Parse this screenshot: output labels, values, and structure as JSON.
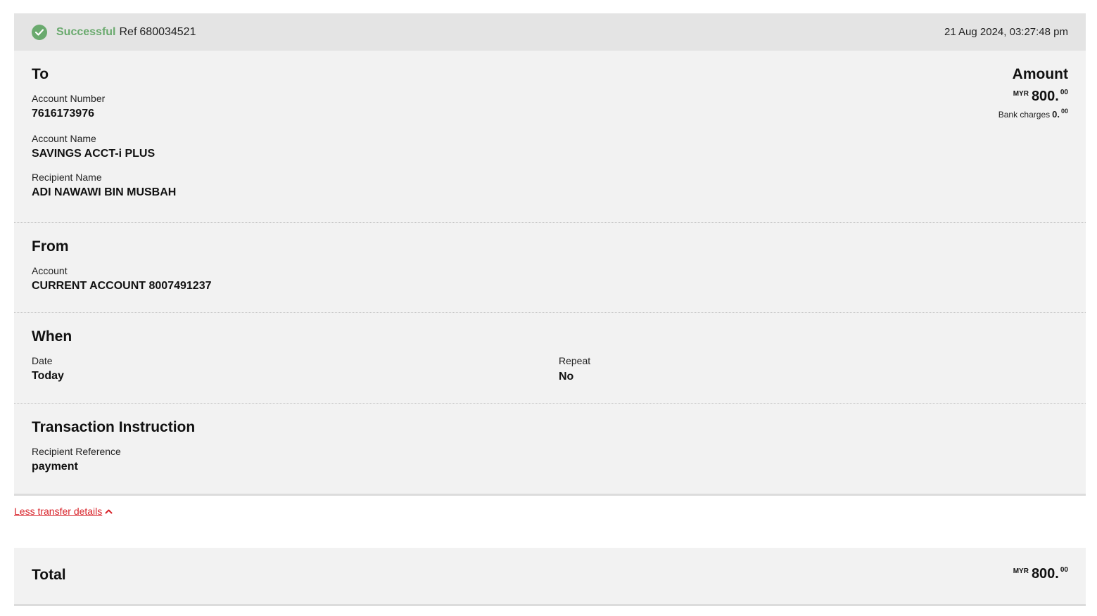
{
  "header": {
    "status": "Successful",
    "ref_label": "Ref",
    "ref_number": "680034521",
    "timestamp": "21 Aug 2024, 03:27:48 pm",
    "status_color": "#6aaa6e"
  },
  "to": {
    "title": "To",
    "account_number_label": "Account Number",
    "account_number": "7616173976",
    "account_name_label": "Account Name",
    "account_name": "SAVINGS ACCT-i PLUS",
    "recipient_name_label": "Recipient Name",
    "recipient_name": "ADI NAWAWI BIN MUSBAH"
  },
  "amount": {
    "title": "Amount",
    "currency": "MYR",
    "integer": "800.",
    "decimals": "00",
    "bank_charges_label": "Bank charges",
    "bank_charges_integer": "0.",
    "bank_charges_decimals": "00"
  },
  "from": {
    "title": "From",
    "account_label": "Account",
    "account_value": "CURRENT ACCOUNT 8007491237"
  },
  "when": {
    "title": "When",
    "date_label": "Date",
    "date_value": "Today",
    "repeat_label": "Repeat",
    "repeat_value": "No"
  },
  "instruction": {
    "title": "Transaction Instruction",
    "recipient_reference_label": "Recipient Reference",
    "recipient_reference_value": "payment"
  },
  "toggle": {
    "label": "Less transfer details",
    "icon": "chevron-up-icon",
    "color": "#d8232a"
  },
  "total": {
    "title": "Total",
    "currency": "MYR",
    "integer": "800.",
    "decimals": "00"
  }
}
